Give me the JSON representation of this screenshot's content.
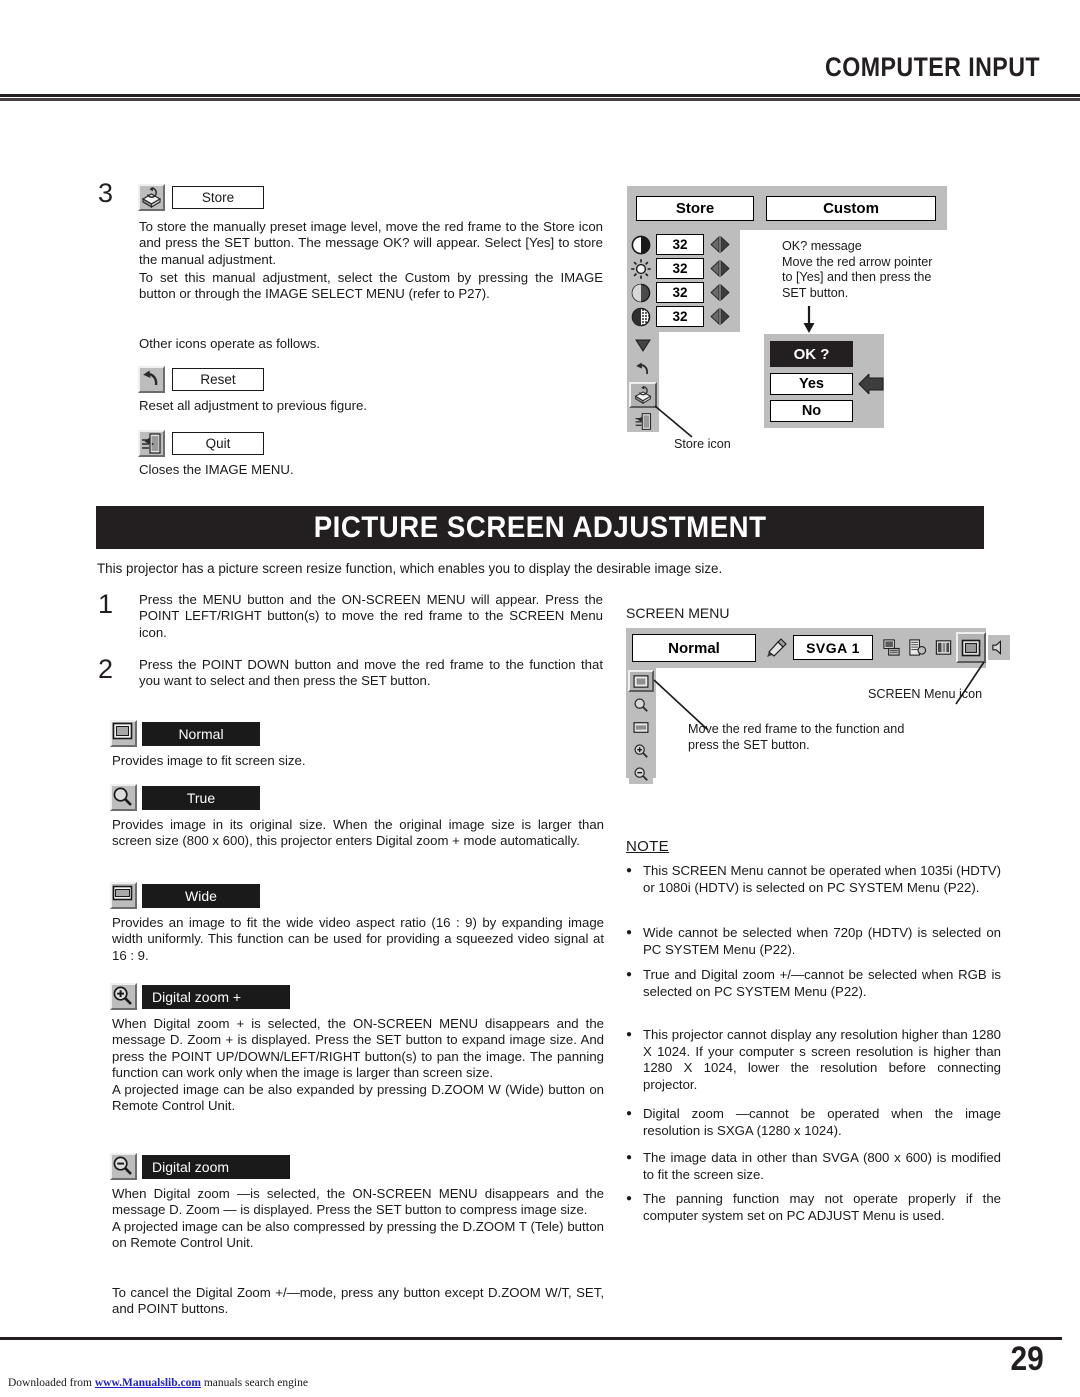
{
  "header": {
    "title": "COMPUTER INPUT"
  },
  "step3": {
    "number": "3",
    "store_label": "Store",
    "paragraph1": "To store the manually preset image level, move the red frame to the Store icon and press the SET button.  The message  OK?  will appear.  Select [Yes] to store the manual adjustment.",
    "paragraph2": "To set this manual adjustment, select the Custom by pressing the IMAGE button or through the IMAGE SELECT MENU (refer to P27).",
    "other_icons_line": "Other icons operate as follows.",
    "reset_label": "Reset",
    "reset_desc": "Reset all adjustment to previous figure.",
    "quit_label": "Quit",
    "quit_desc": "Closes the IMAGE MENU."
  },
  "image_menu_mock": {
    "store_button": "Store",
    "custom_button": "Custom",
    "values": [
      "32",
      "32",
      "32",
      "32"
    ],
    "callout": "OK?  message\nMove the red arrow pointer\nto [Yes] and then press the\nSET button.",
    "dialog": {
      "title": "OK ?",
      "yes": "Yes",
      "no": "No"
    },
    "store_icon_caption": "Store icon"
  },
  "section": {
    "title": "PICTURE SCREEN ADJUSTMENT"
  },
  "intro": "This projector has a picture screen resize function, which enables you to display the desirable image size.",
  "steps": [
    {
      "number": "1",
      "text": "Press the MENU button and the ON-SCREEN MENU will appear.  Press the POINT LEFT/RIGHT button(s) to move the red frame to the SCREEN Menu icon."
    },
    {
      "number": "2",
      "text": "Press the POINT DOWN button and move the red frame to the function that you want to select and then press the SET button."
    }
  ],
  "screen_menu_mock": {
    "title": "SCREEN MENU",
    "normal_button": "Normal",
    "system_value": "SVGA  1",
    "menu_icon_caption": "SCREEN Menu icon",
    "frame_caption": "Move the red frame to the function and\npress the SET button."
  },
  "functions": [
    {
      "label": "Normal",
      "icon": "screen-normal-icon",
      "desc": "Provides image to fit screen size."
    },
    {
      "label": "True",
      "icon": "magnifier-icon",
      "desc": "Provides image in its original size.  When the original image size is larger than screen size (800 x 600), this projector enters  Digital zoom +  mode automatically."
    },
    {
      "label": "Wide",
      "icon": "screen-wide-icon",
      "desc": "Provides an image to fit the wide video aspect ratio (16 : 9) by expanding image width uniformly.  This function can be used for providing a squeezed video signal at 16 : 9."
    },
    {
      "label": "Digital zoom +",
      "icon": "magnifier-plus-icon",
      "desc": "When Digital zoom + is selected, the ON-SCREEN MENU disappears and the message  D. Zoom +  is displayed.  Press the SET button to expand image size.  And press the POINT UP/DOWN/LEFT/RIGHT button(s) to pan the image.  The panning function can work only when the image is larger than screen size.\nA projected image can be also expanded by pressing D.ZOOM W (Wide) button on Remote Control Unit."
    },
    {
      "label": "Digital zoom",
      "icon": "magnifier-minus-icon",
      "desc": "When Digital zoom —is selected, the ON-SCREEN MENU disappears and the message  D. Zoom — is displayed.  Press the SET button to compress image size.\nA projected image can be also compressed by pressing the D.ZOOM T (Tele) button on Remote Control Unit."
    }
  ],
  "cancel_note": "To cancel the Digital Zoom +/—mode, press any button except D.ZOOM W/T, SET, and POINT buttons.",
  "note": {
    "title": "NOTE",
    "items": [
      "This SCREEN Menu cannot be operated when  1035i (HDTV)  or  1080i (HDTV)  is selected on PC SYSTEM Menu  (P22).",
      "Wide cannot be selected when  720p (HDTV)  is selected on PC SYSTEM Menu  (P22).",
      "True and Digital zoom +/—cannot be selected when  RGB  is selected on PC SYSTEM Menu (P22).",
      "This projector cannot display any resolution higher than 1280 X 1024.  If your computer s screen resolution is higher than 1280 X 1024, lower the resolution before connecting projector.",
      "Digital zoom —cannot be operated when the image resolution is SXGA (1280 x 1024).",
      "The image data in other than SVGA (800 x 600) is modified to fit the screen size.",
      "The panning function may not operate properly if the computer system set on PC ADJUST Menu is used."
    ]
  },
  "footer": {
    "page_number": "29",
    "credit_prefix": "Downloaded from ",
    "credit_link": "www.Manualslib.com",
    "credit_suffix": " manuals search engine"
  }
}
